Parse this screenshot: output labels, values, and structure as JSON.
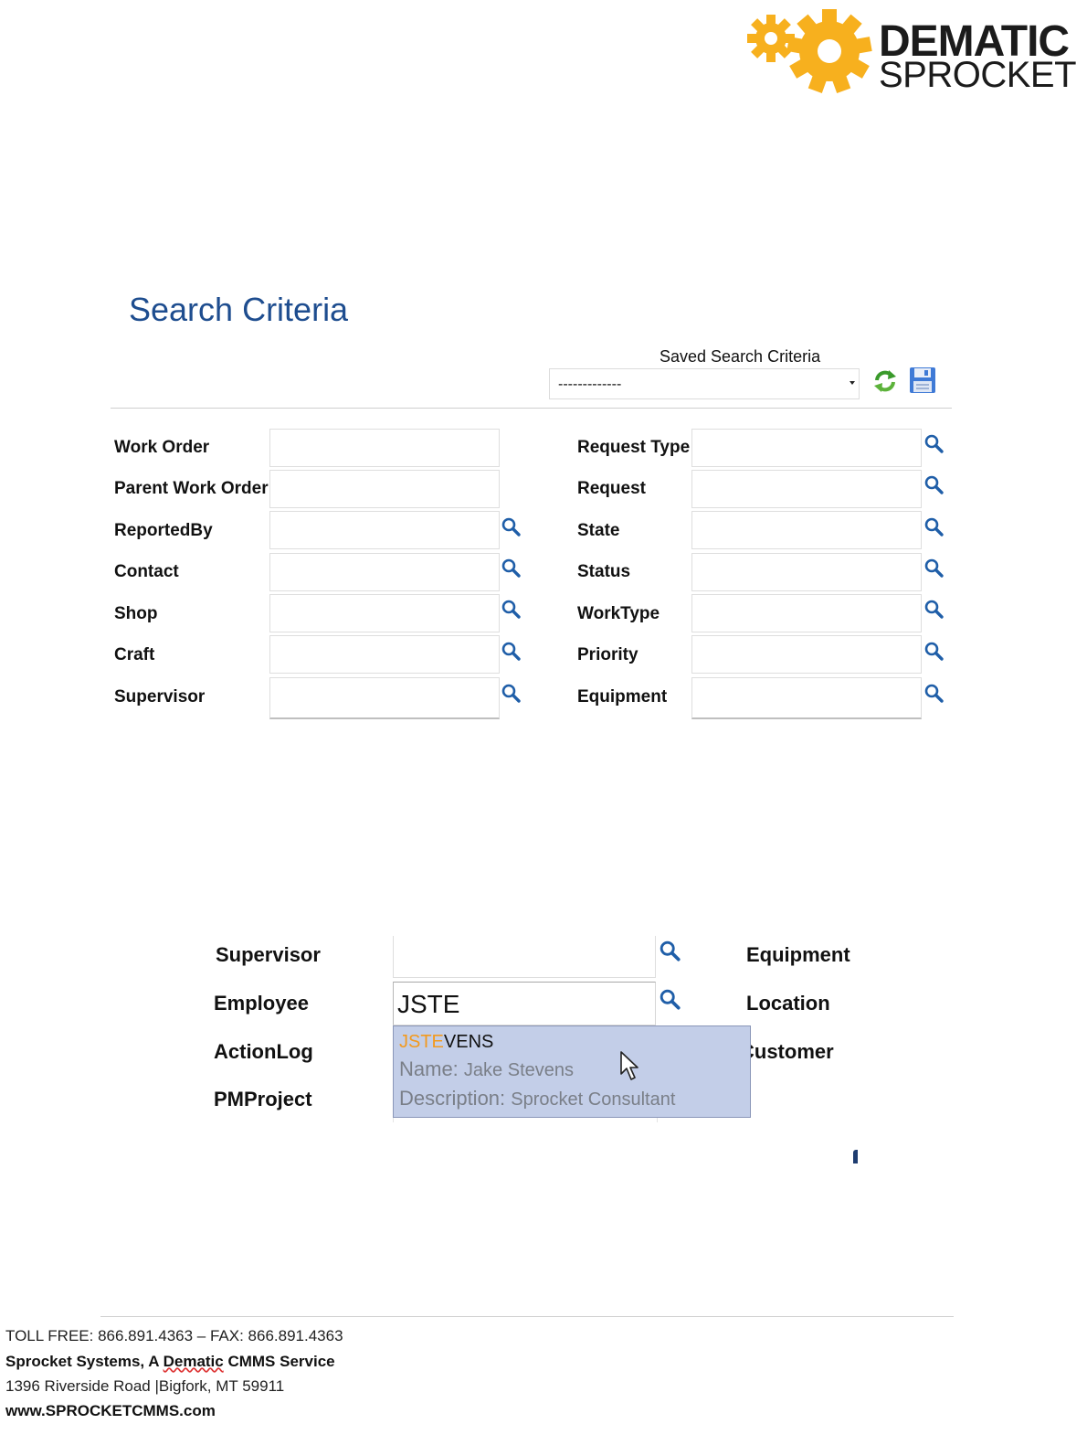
{
  "logo": {
    "line1": "DEMATIC",
    "line2": "SPROCKET",
    "gear_color": "#f7b01e"
  },
  "search": {
    "title": "Search Criteria",
    "saved_label": "Saved Search Criteria",
    "saved_value": "-------------"
  },
  "left_fields": [
    {
      "label": "Work Order",
      "lookup": false
    },
    {
      "label": "Parent Work Order",
      "lookup": false
    },
    {
      "label": "ReportedBy",
      "lookup": true
    },
    {
      "label": "Contact",
      "lookup": true
    },
    {
      "label": "Shop",
      "lookup": true
    },
    {
      "label": "Craft",
      "lookup": true
    },
    {
      "label": "Supervisor",
      "lookup": true
    }
  ],
  "right_fields": [
    {
      "label": "Request Type",
      "lookup": true
    },
    {
      "label": "Request",
      "lookup": true
    },
    {
      "label": "State",
      "lookup": true
    },
    {
      "label": "Status",
      "lookup": true
    },
    {
      "label": "WorkType",
      "lookup": true
    },
    {
      "label": "Priority",
      "lookup": true
    },
    {
      "label": "Equipment",
      "lookup": true
    }
  ],
  "zoom": {
    "left_labels": [
      "Supervisor",
      "Employee",
      "ActionLog",
      "PMProject"
    ],
    "right_labels": [
      "Equipment",
      "Location",
      "Customer"
    ],
    "employee_value": "JSTE",
    "suggestion": {
      "match": "JSTE",
      "rest": "VENS",
      "name_label": "Name:",
      "name_value": "Jake Stevens",
      "desc_label": "Description:",
      "desc_value": "Sprocket Consultant"
    }
  },
  "footer": {
    "line1": "TOLL FREE: 866.891.4363 – FAX: 866.891.4363",
    "line2_a": "Sprocket Systems, A ",
    "line2_b": "Dematic",
    "line2_c": " CMMS Service",
    "line3": "1396 Riverside  Road |Bigfork, MT 59911",
    "line4": "www.SPROCKETCMMS.com"
  }
}
